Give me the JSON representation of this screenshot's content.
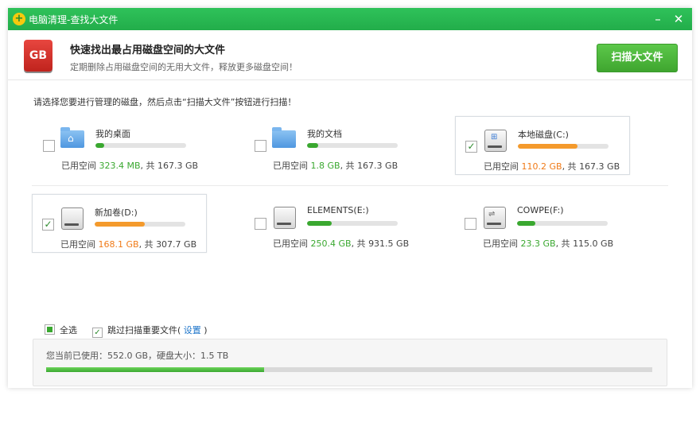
{
  "window": {
    "title": "电脑清理-查找大文件",
    "minimize": "–",
    "close": "✕"
  },
  "header": {
    "logo": "GB",
    "title": "快速找出最占用磁盘空间的大文件",
    "subtitle": "定期删除占用磁盘空间的无用大文件，释放更多磁盘空间！",
    "scan_button": "扫描大文件"
  },
  "instruction": "请选择您要进行管理的磁盘，然后点击“扫描大文件”按钮进行扫描！",
  "disks": [
    {
      "name": "我的桌面",
      "icon": "desktop-folder-icon",
      "checked": false,
      "selected": false,
      "used": "323.4 MB",
      "total": "167.3 GB",
      "fill_fraction": 0.1,
      "color": "#3aa830",
      "used_style": "green"
    },
    {
      "name": "我的文档",
      "icon": "documents-folder-icon",
      "checked": false,
      "selected": false,
      "used": "1.8 GB",
      "total": "167.3 GB",
      "fill_fraction": 0.12,
      "color": "#3aa830",
      "used_style": "green"
    },
    {
      "name": "本地磁盘(C:)",
      "icon": "system-drive-icon",
      "checked": true,
      "selected": true,
      "used": "110.2 GB",
      "total": "167.3 GB",
      "fill_fraction": 0.66,
      "color": "#f49a2c",
      "used_style": "orange"
    },
    {
      "name": "新加卷(D:)",
      "icon": "hard-drive-icon",
      "checked": true,
      "selected": true,
      "used": "168.1 GB",
      "total": "307.7 GB",
      "fill_fraction": 0.55,
      "color": "#f49a2c",
      "used_style": "orange"
    },
    {
      "name": "ELEMENTS(E:)",
      "icon": "hard-drive-icon",
      "checked": false,
      "selected": false,
      "used": "250.4 GB",
      "total": "931.5 GB",
      "fill_fraction": 0.27,
      "color": "#3aa830",
      "used_style": "green"
    },
    {
      "name": "COWPE(F:)",
      "icon": "usb-drive-icon",
      "checked": false,
      "selected": false,
      "used": "23.3 GB",
      "total": "115.0 GB",
      "fill_fraction": 0.2,
      "color": "#3aa830",
      "used_style": "green"
    }
  ],
  "usage_prefix": "已用空间 ",
  "usage_sep": ", 共 ",
  "check_mark": "✓",
  "select_all": "全选",
  "skip_important": "跳过扫描重要文件(",
  "settings_link": "设置",
  "settings_close": ")",
  "summary": {
    "text": "您当前已使用：552.0 GB，硬盘大小：1.5 TB",
    "fill_fraction": 0.36
  }
}
